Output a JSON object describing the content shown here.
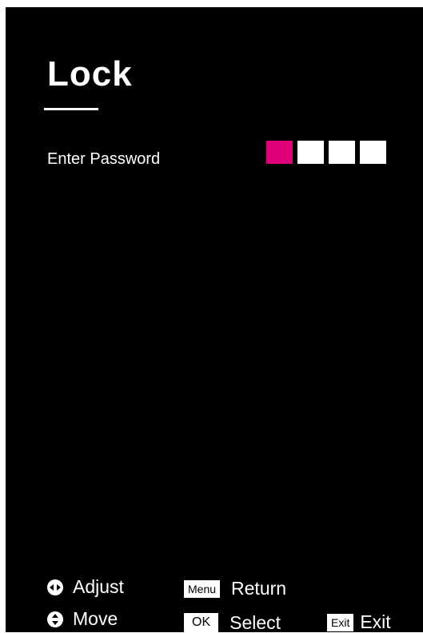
{
  "menu": {
    "title": "Lock",
    "field_label": "Enter Password",
    "pin": {
      "length": 4,
      "active_index": 0,
      "active_color": "#e0007a",
      "inactive_color": "#ffffff"
    }
  },
  "footer": {
    "adjust": {
      "icon": "left-right-dpad-icon",
      "label": "Adjust"
    },
    "move": {
      "icon": "up-down-dpad-icon",
      "label": "Move"
    },
    "return": {
      "key": "Menu",
      "label": "Return"
    },
    "select": {
      "key": "OK",
      "label": "Select"
    },
    "exit": {
      "key": "Exit",
      "label": "Exit"
    }
  }
}
